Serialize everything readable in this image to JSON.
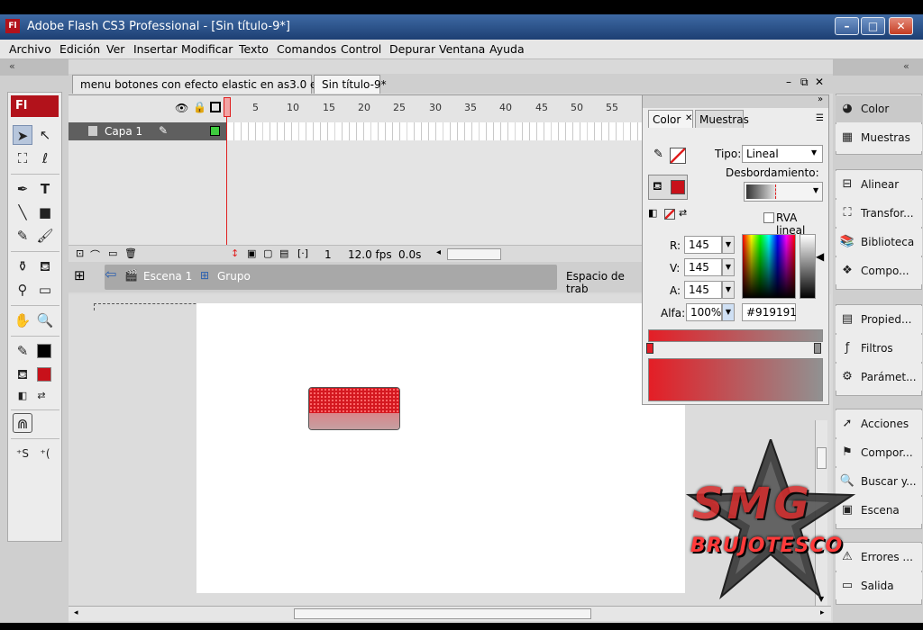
{
  "window": {
    "app_icon": "Fl",
    "title": "Adobe Flash CS3 Professional - [Sin título-9*]",
    "minimize": "–",
    "maximize": "□",
    "close": "✕"
  },
  "menu": [
    "Archivo",
    "Edición",
    "Ver",
    "Insertar",
    "Modificar",
    "Texto",
    "Comandos",
    "Control",
    "Depurar",
    "Ventana",
    "Ayuda"
  ],
  "toolbox": {
    "logo": "Fl"
  },
  "doc_tabs": [
    {
      "label": "menu botones con efecto elastic en as3.0 en flash",
      "active": false
    },
    {
      "label": "Sin título-9*",
      "active": true
    }
  ],
  "doc_controls": {
    "min": "–",
    "restore": "⧉",
    "close": "✕"
  },
  "timeline": {
    "ruler": [
      "5",
      "10",
      "15",
      "20",
      "25",
      "30",
      "35",
      "40",
      "45",
      "50",
      "55"
    ],
    "layer_name": "Capa 1",
    "current_frame": "1",
    "fps": "12.0 fps",
    "time": "0.0s"
  },
  "editbar": {
    "scene": "Escena 1",
    "group": "Grupo",
    "workspace": "Espacio de trab"
  },
  "color_panel": {
    "tabs": [
      "Color",
      "Muestras"
    ],
    "tipo_label": "Tipo:",
    "tipo_value": "Lineal",
    "overflow_label": "Desbordamiento:",
    "rva_label": "RVA lineal",
    "r_label": "R:",
    "r_value": "145",
    "g_label": "V:",
    "g_value": "145",
    "b_label": "A:",
    "b_value": "145",
    "alpha_label": "Alfa:",
    "alpha_value": "100%",
    "hex": "#919191"
  },
  "right_panels": {
    "group1": [
      {
        "label": "Color",
        "icon": "color-icon"
      },
      {
        "label": "Muestras",
        "icon": "swatches-icon"
      }
    ],
    "group2": [
      {
        "label": "Alinear",
        "icon": "align-icon"
      },
      {
        "label": "Transfor...",
        "icon": "transform-icon"
      },
      {
        "label": "Biblioteca",
        "icon": "library-icon"
      },
      {
        "label": "Compo...",
        "icon": "components-icon"
      }
    ],
    "group3": [
      {
        "label": "Propied...",
        "icon": "properties-icon"
      },
      {
        "label": "Filtros",
        "icon": "filters-icon"
      },
      {
        "label": "Parámet...",
        "icon": "parameters-icon"
      }
    ],
    "group4": [
      {
        "label": "Acciones",
        "icon": "actions-icon"
      },
      {
        "label": "Compor...",
        "icon": "behaviors-icon"
      },
      {
        "label": "Buscar y...",
        "icon": "find-icon"
      },
      {
        "label": "Escena",
        "icon": "scene-icon"
      }
    ],
    "group5": [
      {
        "label": "Errores ...",
        "icon": "errors-icon"
      },
      {
        "label": "Salida",
        "icon": "output-icon"
      }
    ]
  },
  "watermark": {
    "text": "BRUJOTESCO",
    "initials": "SMG"
  },
  "colors": {
    "accent_red": "#e41e26",
    "gray": "#919191",
    "title_blue": "#2a5082"
  }
}
